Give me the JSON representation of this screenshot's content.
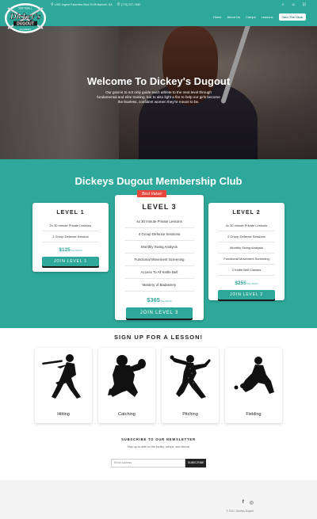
{
  "brand": {
    "logo_name": "Dickey's",
    "logo_sub": "DUGOUT",
    "logo_top": "SOFTBALL",
    "logo_bottom": "ACADEMY"
  },
  "topbar": {
    "address": "1451 Argent Fakeview Blvd St 08 Bamold, SA",
    "phone": "(770) 237-7480"
  },
  "nav": {
    "items": [
      "Home",
      "About Us",
      "Camps",
      "Lessons"
    ],
    "join": "Join The Club"
  },
  "hero": {
    "title": "Welcome To Dickey's Dugout",
    "text": "Our goal is to not only guide each athlete to the next level through fundamental and elite training, but to also light a fire to help our girls become the fearless, confident women they're meant to be."
  },
  "membership": {
    "title": "Dickeys Dugout Membership Club",
    "badge": "Best Value!",
    "levels": [
      {
        "name": "LEVEL 1",
        "features": [
          "2x 30 minute Private Lessons",
          "1 Group Defense Session"
        ],
        "price": "$125",
        "per": "Per Month",
        "button": "JOIN LEVEL 1"
      },
      {
        "name": "LEVEL 3",
        "features": [
          "4x 30 minute Private Lessons",
          "4 Group Defense Sessions",
          "Monthly Swing Analysis",
          "Functional Movement Screening",
          "Access To All Kettle Bell",
          "Mastery of Badassery"
        ],
        "price": "$365",
        "per": "Per Month",
        "button": "JOIN LEVEL 3"
      },
      {
        "name": "LEVEL 2",
        "features": [
          "4x 30 minute Private Lessons",
          "2 Group Defense Sessions",
          "Monthly Swing Analysis",
          "Functional Movement Screening",
          "2 Kettle Bell Classes"
        ],
        "price": "$255",
        "per": "Per Month",
        "button": "JOIN LEVEL 2"
      }
    ]
  },
  "lessons": {
    "title": "SIGN UP FOR A LESSON!",
    "items": [
      {
        "label": "Hitting",
        "icon": "batter-silhouette-icon"
      },
      {
        "label": "Catching",
        "icon": "catcher-silhouette-icon"
      },
      {
        "label": "Pitching",
        "icon": "pitcher-silhouette-icon"
      },
      {
        "label": "Fielding",
        "icon": "fielder-silhouette-icon"
      }
    ]
  },
  "newsletter": {
    "title": "SUBSCRIBE TO OUR NEWSLETTER",
    "subtitle": "Stay up-to-date on the facility, camps, and discos!",
    "placeholder": "Email address",
    "button": "SUBSCRIBE"
  },
  "footer": {
    "copyright": "© 2021, Dickeys Dugout"
  },
  "colors": {
    "teal": "#2ea89a",
    "badge": "#e8453c"
  }
}
